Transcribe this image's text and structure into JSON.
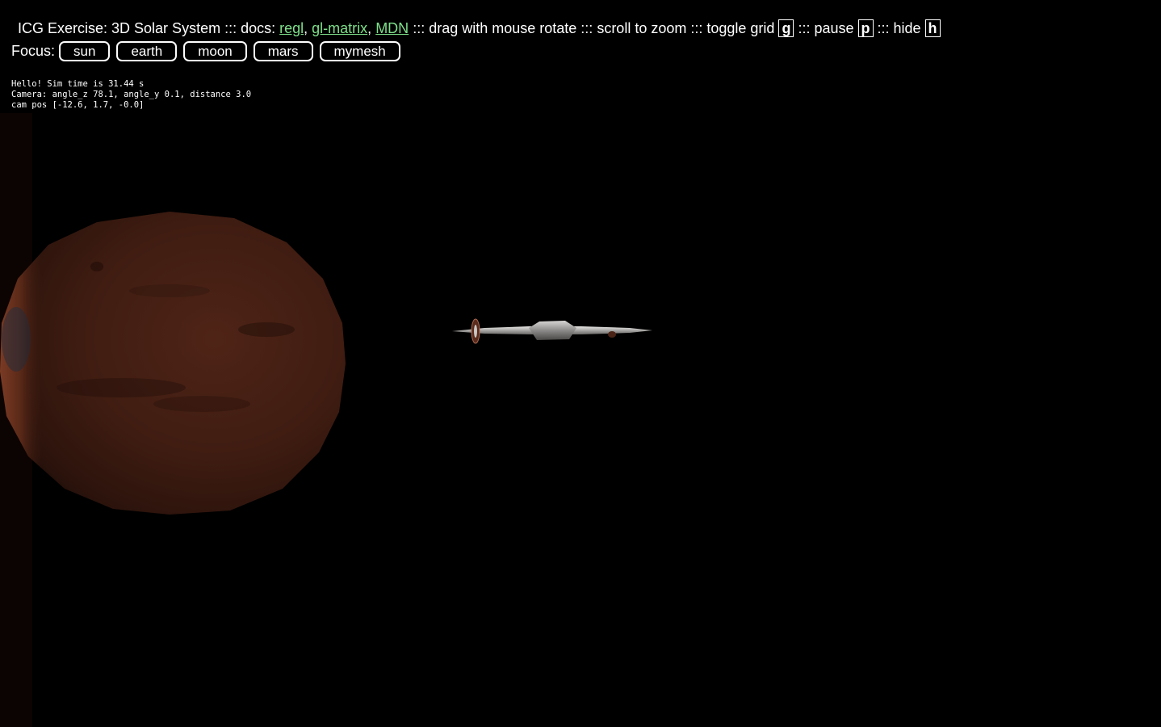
{
  "header": {
    "title": "ICG Exercise: 3D Solar System",
    "sep": ":::",
    "docs_label": "docs:",
    "docs_links": [
      "regl",
      "gl-matrix",
      "MDN"
    ],
    "link_comma": ",",
    "drag_text": "drag with mouse rotate",
    "scroll_text": "scroll to zoom",
    "grid_text": "toggle grid",
    "grid_key": "g",
    "pause_text": "pause",
    "pause_key": "p",
    "hide_text": "hide",
    "hide_key": "h"
  },
  "focus": {
    "label": "Focus:",
    "buttons": [
      "sun",
      "earth",
      "moon",
      "mars",
      "mymesh"
    ]
  },
  "debug": {
    "line1": "Hello! Sim time is 31.44 s",
    "line2": "Camera: angle_z 78.1, angle_y 0.1, distance 3.0",
    "line3": "cam pos [-12.6, 1.7, -0.0]"
  },
  "colors": {
    "background": "#000000",
    "link": "#7ee08a",
    "mars": "#5a2a1c"
  }
}
